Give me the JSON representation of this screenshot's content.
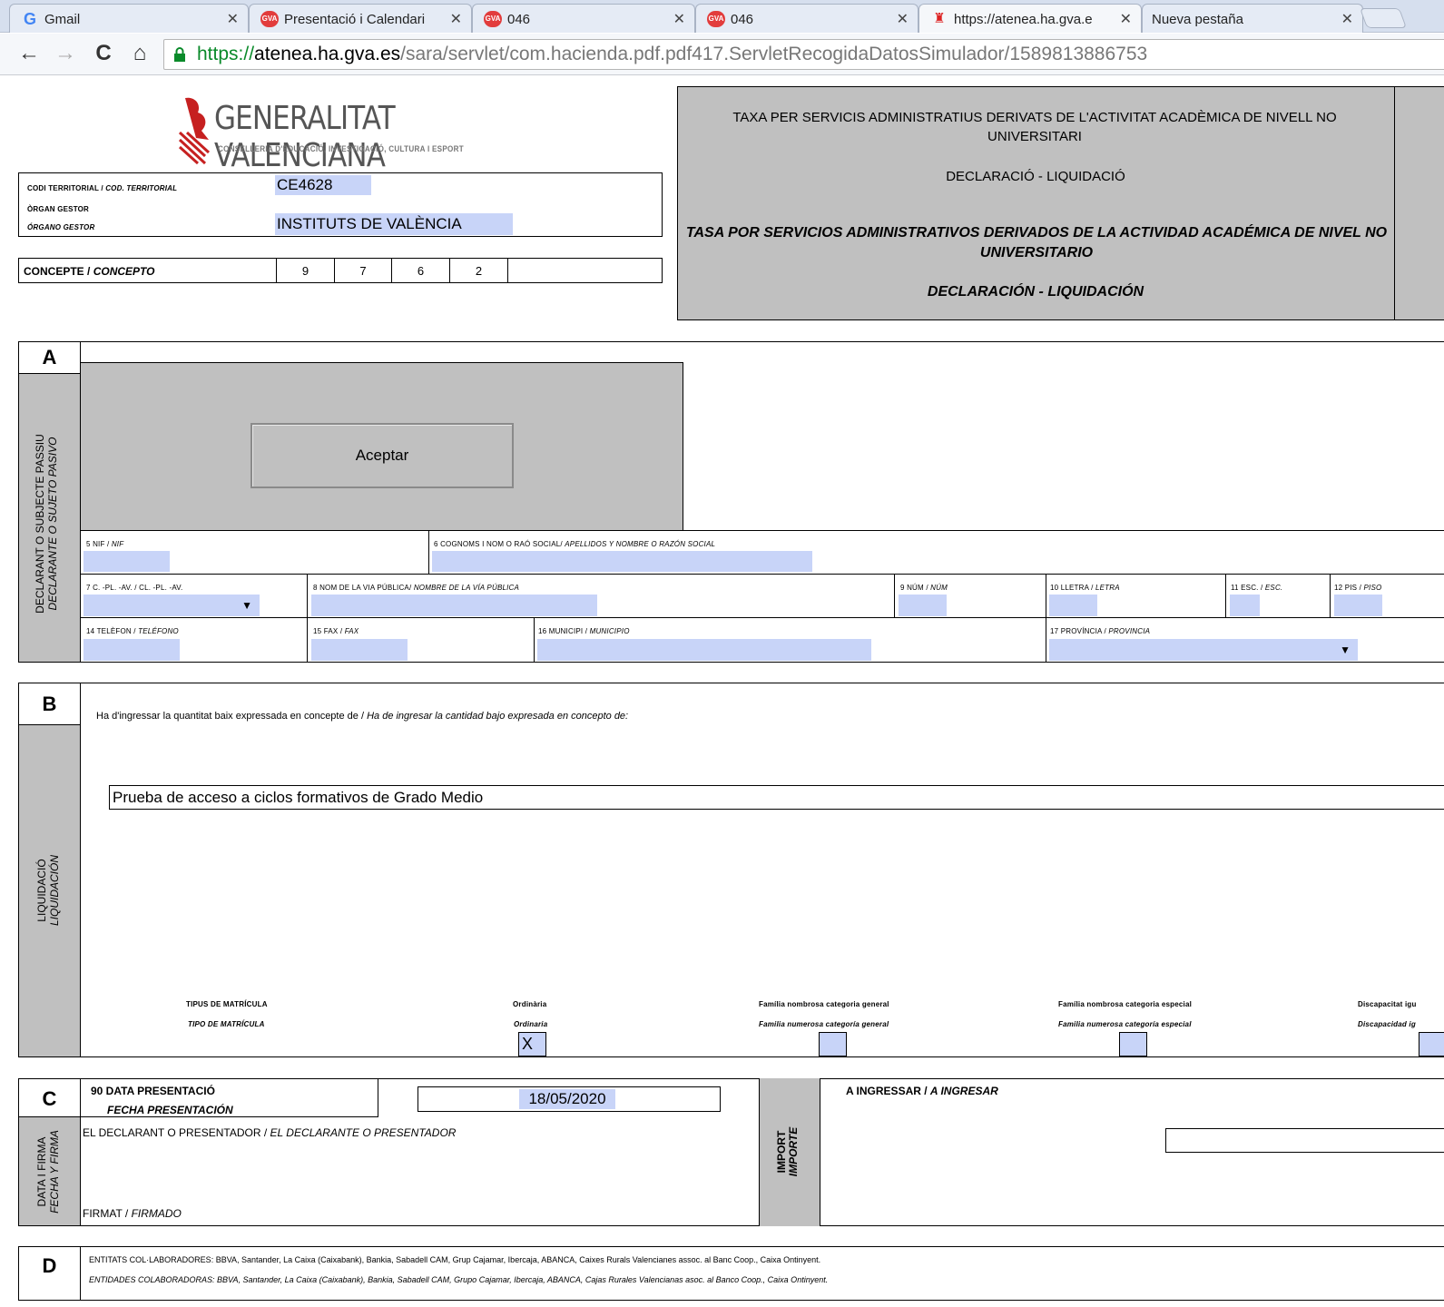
{
  "browser": {
    "tabs": [
      {
        "title": "Gmail",
        "favicon": "gmail-icon"
      },
      {
        "title": "Presentació i Calendari",
        "favicon": "gva-icon"
      },
      {
        "title": "046",
        "favicon": "gva-icon"
      },
      {
        "title": "046",
        "favicon": "gva-icon"
      },
      {
        "title": "https://atenea.ha.gva.e",
        "favicon": "gv-logo-icon"
      },
      {
        "title": "Nueva pestaña",
        "favicon": ""
      }
    ],
    "url_scheme": "https://",
    "url_domain": "atenea.ha.gva.es",
    "url_path": "/sara/servlet/com.hacienda.pdf.pdf417.ServletRecogidaDatosSimulador/1589813886753"
  },
  "header": {
    "logo_title": "GENERALITAT VALENCIANA",
    "logo_subtitle": "CONSELLERIA D'EDUCACIÓ, INVESTIGACIÓ, CULTURA I ESPORT",
    "codi_label_va": "CODI TERRITORIAL / ",
    "codi_label_es": "COD. TERRITORIAL",
    "codi_value": "CE4628",
    "organ_label_va": "ÒRGAN GESTOR",
    "organ_label_es": "ÓRGANO GESTOR",
    "organ_value": "INSTITUTS DE VALÈNCIA",
    "concepte_label_va": "CONCEPTE / ",
    "concepte_label_es": "CONCEPTO",
    "concepte_digits": [
      "9",
      "7",
      "6",
      "2"
    ]
  },
  "titlebox": {
    "va_title": "TAXA PER SERVICIS ADMINISTRATIUS DERIVATS DE L'ACTIVITAT ACADÈMICA DE NIVELL NO UNIVERSITARI",
    "va_subtitle": "DECLARACIÓ - LIQUIDACIÓ",
    "es_title": "TASA POR SERVICIOS ADMINISTRATIVOS DERIVADOS DE LA ACTIVIDAD ACADÉMICA DE NIVEL NO UNIVERSITARIO",
    "es_subtitle": "DECLARACIÓN - LIQUIDACIÓN"
  },
  "sectionA": {
    "letter": "A",
    "side_va": "DECLARANT O SUBJECTE PASSIU",
    "side_es": "DECLARANTE O SUJETO PASIVO",
    "accept_button": "Aceptar",
    "f5_va": "5  NIF / ",
    "f5_es": "NIF",
    "f6_va": "6  COGNOMS I NOM O RAÓ SOCIAL/ ",
    "f6_es": "APELLIDOS Y NOMBRE O RAZÓN SOCIAL",
    "f7_va": "7  C. -PL. -AV. / CL. -PL. -AV.",
    "f7_es": "",
    "f8_va": "8  NOM DE LA VIA PÚBLICA/ ",
    "f8_es": "NOMBRE DE LA VÍA PÚBLICA",
    "f9_va": "9  NÚM / ",
    "f9_es": "NÚM",
    "f10_va": "10  LLETRA / ",
    "f10_es": "LETRA",
    "f11_va": "11  ESC. / ",
    "f11_es": "ESC.",
    "f12_va": "12  PIS / ",
    "f12_es": "PISO",
    "f14_va": "14  TELÈFON / ",
    "f14_es": "TELÉFONO",
    "f15_va": "15  FAX / ",
    "f15_es": "FAX",
    "f16_va": "16  MUNICIPI / ",
    "f16_es": "MUNICIPIO",
    "f17_va": "17  PROVÍNCIA / ",
    "f17_es": "PROVINCIA"
  },
  "sectionB": {
    "letter": "B",
    "side_va": "LIQUIDACIÓ",
    "side_es": "LIQUIDACIÓN",
    "intro_va": "Ha d'ingressar la quantitat baix expressada en concepte de / ",
    "intro_es": "Ha de ingresar la cantidad bajo expresada en concepto de:",
    "concept_value": "Prueba de acceso a ciclos formativos de Grado Medio",
    "tipus_va": "TIPUS DE MATRÍCULA",
    "tipus_es": "TIPO DE MATRÍCULA",
    "options": [
      {
        "va": "Ordinària",
        "es": "Ordinaria",
        "value": "X"
      },
      {
        "va": "Família nombrosa categoria general",
        "es": "Familia numerosa categoría general",
        "value": ""
      },
      {
        "va": "Família nombrosa categoria especial",
        "es": "Familia numerosa categoría especial",
        "value": ""
      },
      {
        "va": "Discapacitat igu",
        "es": "Discapacidad ig",
        "value": ""
      }
    ]
  },
  "sectionC": {
    "letter": "C",
    "side_va": "DATA I FIRMA",
    "side_es": "FECHA Y FIRMA",
    "date_label_va": "90 DATA PRESENTACIÓ",
    "date_label_es": "FECHA PRESENTACIÓN",
    "date_value": "18/05/2020",
    "declarant_va": "EL DECLARANT O PRESENTADOR / ",
    "declarant_es": "EL DECLARANTE O PRESENTADOR",
    "firmat_va": "FIRMAT / ",
    "firmat_es": "FIRMADO",
    "import_va": "IMPORT",
    "import_es": "IMPORTE",
    "ingressar_va": "A INGRESSAR / ",
    "ingressar_es": "A INGRESAR"
  },
  "sectionD": {
    "letter": "D",
    "line_va": "ENTITATS COL·LABORADORES: BBVA, Santander, La Caixa (Caixabank), Bankia, Sabadell CAM, Grup Cajamar, Ibercaja, ABANCA, Caixes Rurals Valencianes assoc. al Banc Coop., Caixa Ontinyent.",
    "line_es": "ENTIDADES COLABORADORAS: BBVA, Santander, La Caixa (Caixabank), Bankia, Sabadell CAM, Grupo Cajamar, Ibercaja, ABANCA, Cajas Rurales Valencianas asoc. al Banco Coop., Caixa Ontinyent."
  }
}
